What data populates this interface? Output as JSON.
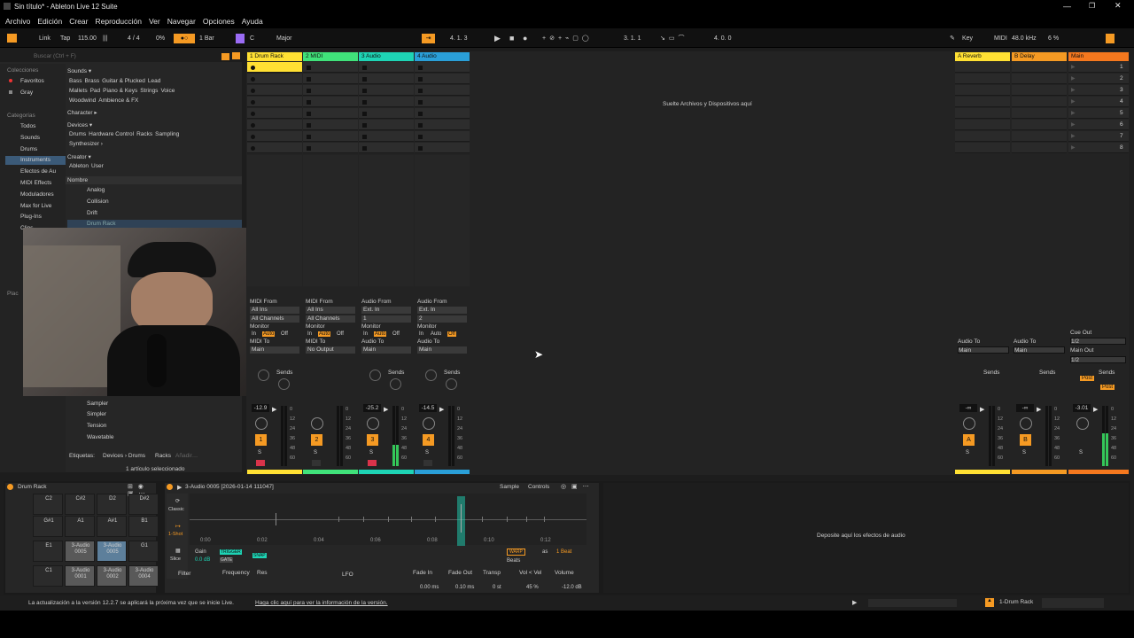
{
  "window": {
    "title": "Sin título* - Ableton Live 12 Suite"
  },
  "menu": [
    "Archivo",
    "Edición",
    "Crear",
    "Reproducción",
    "Ver",
    "Navegar",
    "Opciones",
    "Ayuda"
  ],
  "transport": {
    "link": "Link",
    "tap": "Tap",
    "tempo": "115.00",
    "signature": "4 / 4",
    "cpu_pct": "0%",
    "quantize": "1 Bar",
    "key": "C",
    "scale": "Major",
    "position": "4.  1.  3",
    "loop_start": "3.  1.  1",
    "loop_length": "4.  0.  0",
    "key_label": "Key",
    "midi_label": "MIDI",
    "sample_rate": "48.0 kHz",
    "cpu": "6 %"
  },
  "browser": {
    "search_placeholder": "Buscar (Ctrl + F)",
    "left_headers": {
      "collections": "Colecciones",
      "categories": "Categorías",
      "places": "Plac"
    },
    "collections": [
      "Favoritos",
      "Gray"
    ],
    "categories": [
      "Todos",
      "Sounds",
      "Drums",
      "Instruments",
      "Efectos de Au",
      "MIDI Effects",
      "Moduladores",
      "Max for Live",
      "Plug-Ins",
      "Clips"
    ],
    "sounds_header": "Sounds ▾",
    "sounds_tags": [
      [
        "Bass",
        "Brass",
        "Guitar & Plucked",
        "Lead"
      ],
      [
        "Mallets",
        "Pad",
        "Piano & Keys",
        "Strings",
        "Voice"
      ],
      [
        "Woodwind",
        "Ambience & FX"
      ]
    ],
    "character": "Character ▸",
    "devices_header": "Devices ▾",
    "devices_tags": [
      [
        "Drums",
        "Hardware Control",
        "Racks",
        "Sampling"
      ],
      [
        "Synthesizer ›"
      ]
    ],
    "creator": "Creator ▾",
    "creator_tags": [
      "Ableton",
      "User"
    ],
    "name_col": "Nombre",
    "items_top": [
      "Analog",
      "Collision",
      "Drift",
      "Drum Rack"
    ],
    "items_bottom": [
      "Sampler",
      "Simpler",
      "Tension",
      "Wavetable"
    ],
    "tags_label": "Etiquetas:",
    "tags_path": "Devices › Drums",
    "tags_racks": "Racks",
    "tags_add": "Añadir…",
    "selected": "1 artículo seleccionado"
  },
  "tracks": [
    {
      "name": "1 Drum Rack",
      "color": "#ffe033",
      "num": "1",
      "vol": "-12.9",
      "sends": "Sends",
      "midi_from": "MIDI From",
      "from": "All Ins",
      "ch": "All Channels",
      "monitor": "Monitor",
      "to_label": "MIDI To",
      "to": "Main"
    },
    {
      "name": "2 MIDI",
      "color": "#40e27a",
      "num": "2",
      "vol": "",
      "sends": "Sends",
      "midi_from": "MIDI From",
      "from": "All Ins",
      "ch": "All Channels",
      "monitor": "Monitor",
      "to_label": "MIDI To",
      "to": "No Output"
    },
    {
      "name": "3 Audio",
      "color": "#1ed4b5",
      "num": "3",
      "vol": "-25.2",
      "sends": "Sends",
      "midi_from": "Audio From",
      "from": "Ext. In",
      "ch": "1",
      "monitor": "Monitor",
      "to_label": "Audio To",
      "to": "Main"
    },
    {
      "name": "4 Audio",
      "color": "#2a9fd8",
      "num": "4",
      "vol": "-14.5",
      "sends": "Sends",
      "midi_from": "Audio From",
      "from": "Ext. In",
      "ch": "2",
      "monitor": "Monitor",
      "to_label": "Audio To",
      "to": "Main"
    }
  ],
  "monitor_opts": {
    "in": "In",
    "auto": "Auto",
    "off": "Off"
  },
  "drop_text": "Suelte Archivos y Dispositivos aquí",
  "returns": [
    {
      "name": "A Reverb",
      "color": "#ffe033",
      "letter": "A",
      "vol": "-∞",
      "audio_to": "Audio To",
      "to": "Main",
      "sends": "Sends"
    },
    {
      "name": "B Delay",
      "color": "#f59a23",
      "letter": "B",
      "vol": "-∞",
      "audio_to": "Audio To",
      "to": "Main",
      "sends": "Sends"
    },
    {
      "name": "Main",
      "color": "#f5781e",
      "letter": "",
      "vol": "-3.01",
      "audio_to": "",
      "to": "",
      "sends": "Sends"
    }
  ],
  "main_extra": {
    "cue_out": "Cue Out",
    "cue_val": "1/2",
    "main_out": "Main Out",
    "main_val": "1/2",
    "post": "Post"
  },
  "scenes": [
    "1",
    "2",
    "3",
    "4",
    "5",
    "6",
    "7",
    "8"
  ],
  "meter_scale": [
    "0",
    "12",
    "24",
    "36",
    "48",
    "60"
  ],
  "device": {
    "rack": "Drum Rack",
    "pads": [
      [
        "C2",
        "C#2",
        "D2",
        "D#2"
      ],
      [
        "G#1",
        "A1",
        "A#1",
        "B1"
      ],
      [
        "E1",
        "3-Audio 0005",
        "3-Audio 0005",
        "G1"
      ],
      [
        "C1",
        "3-Audio 0001",
        "3-Audio 0002",
        "3-Audio 0004"
      ]
    ],
    "clip": "3-Audio 0005 [2026-01-14 111047]",
    "sample": "Sample",
    "controls": "Controls",
    "classic": "Classic",
    "oneshot": "1-Shot",
    "slice": "Slice",
    "times": [
      "0:00",
      "0:02",
      "0:04",
      "0:06",
      "0:08",
      "0:10",
      "0:12"
    ],
    "gain": "Gain",
    "gain_val": "0.0 dB",
    "trigger": "TRIGGER",
    "gate": "GATE",
    "snap": "SNAP",
    "warp": "WARP",
    "as": "as",
    "beat": "1 Beat",
    "beats": "Beats",
    "filter": "Filter",
    "frequency": "Frequency",
    "res": "Res",
    "lfo": "LFO",
    "fade_in": "Fade In",
    "fade_in_val": "0.00 ms",
    "fade_out": "Fade Out",
    "fade_out_val": "0.10 ms",
    "transp": "Transp",
    "transp_val": "0 st",
    "vol_vel": "Vol < Vel",
    "vol_vel_val": "45 %",
    "volume": "Volume",
    "volume_val": "-12.0 dB"
  },
  "fx_drop": "Deposite aquí los efectos de audio",
  "status": {
    "msg": "La actualización a la versión 12.2.7 se aplicará la próxima vez que se inicie Live.",
    "link": "Haga clic aquí para ver la información de la versión.",
    "track": "1-Drum Rack"
  },
  "colors": {
    "accent": "#f59a23",
    "bg": "#1d1d1d"
  }
}
